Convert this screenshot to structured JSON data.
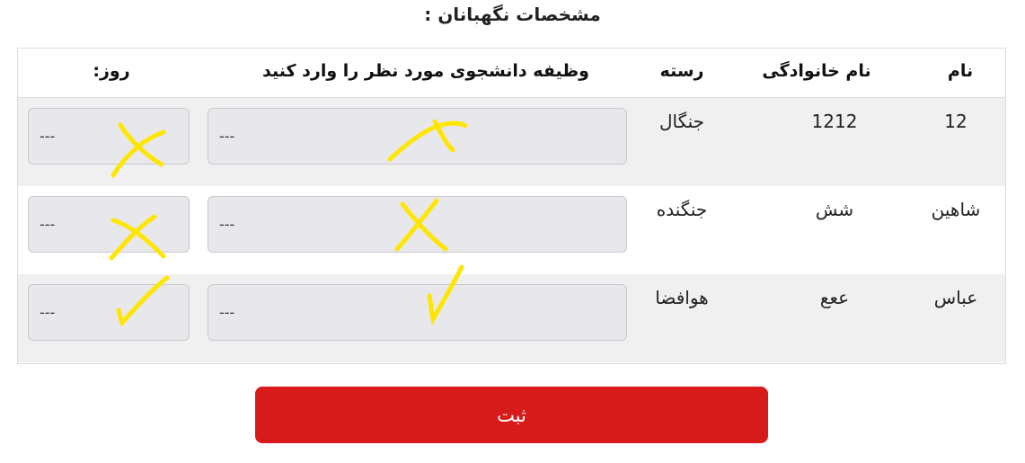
{
  "page": {
    "title": "مشخصات نگهبانان :"
  },
  "table": {
    "headers": {
      "name": "نام",
      "family": "نام خانوادگی",
      "category": "رسته",
      "task": "وظیفه دانشجوی مورد نظر را وارد کنید",
      "day": "روز:"
    },
    "rows": [
      {
        "name": "12",
        "family": "1212",
        "category": "جنگال",
        "task_value": "---",
        "day_value": "---",
        "task_mark": "cross",
        "day_mark": "cross"
      },
      {
        "name": "شاهین",
        "family": "شش",
        "category": "جنگنده",
        "task_value": "---",
        "day_value": "---",
        "task_mark": "cross",
        "day_mark": "cross"
      },
      {
        "name": "عباس",
        "family": "ععع",
        "category": "هوافضا",
        "task_value": "---",
        "day_value": "---",
        "task_mark": "check",
        "day_mark": "check"
      }
    ]
  },
  "actions": {
    "submit_label": "ثبت"
  },
  "colors": {
    "submit_button": "#d71a1a",
    "row_shade": "#f0f0f0",
    "field_background": "#e8e8ec",
    "annotation_marks": "#ffe600"
  }
}
